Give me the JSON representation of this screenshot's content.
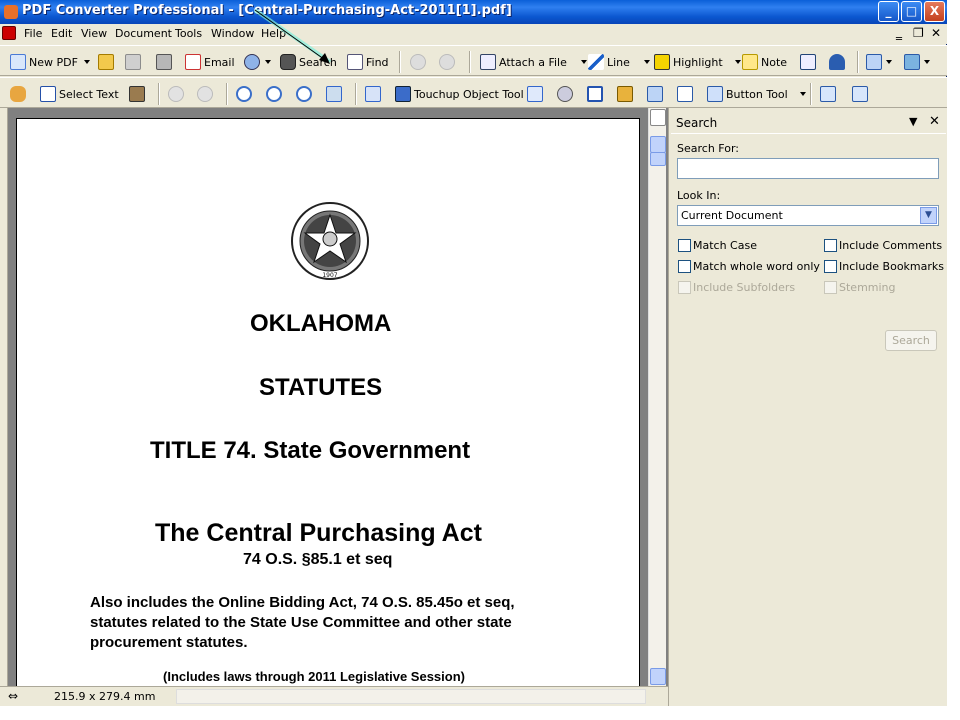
{
  "window": {
    "title": "PDF Converter Professional - [Central-Purchasing-Act-2011[1].pdf]",
    "controls": [
      "_",
      "□",
      "X"
    ]
  },
  "menubar": {
    "items": [
      "File",
      "Edit",
      "View",
      "Document",
      "Tools",
      "Window",
      "Help"
    ]
  },
  "toolbar1": {
    "new_pdf": "New PDF",
    "email": "Email",
    "search": "Search",
    "find": "Find",
    "attach": "Attach a File",
    "line": "Line",
    "highlight": "Highlight",
    "note": "Note"
  },
  "toolbar2": {
    "select_text": "Select Text",
    "touchup": "Touchup Object Tool",
    "button_tool": "Button Tool"
  },
  "document": {
    "line1": "OKLAHOMA",
    "line2": "STATUTES",
    "line3": "TITLE 74.  State Government",
    "line4": "The Central Purchasing Act",
    "line5": "74 O.S. §85.1 et seq",
    "para1": "Also includes the Online Bidding Act, 74 O.S. 85.45o et seq,",
    "para2": "statutes related to the State Use Committee and other state",
    "para3": "procurement statutes.",
    "includes": "(Includes laws through 2011 Legislative Session)",
    "seal_year": "1907"
  },
  "statusbar": {
    "page_size": "215.9 x 279.4 mm"
  },
  "search_panel": {
    "title": "Search",
    "search_for_label": "Search For:",
    "search_for_value": "",
    "look_in_label": "Look In:",
    "look_in_value": "Current Document",
    "match_case": "Match Case",
    "include_comments": "Include Comments",
    "match_whole": "Match whole word only",
    "include_bookmarks": "Include Bookmarks",
    "include_subfolders": "Include Subfolders",
    "stemming": "Stemming",
    "search_button": "Search"
  },
  "colors": {
    "titlebar": "#0b57d0",
    "chrome": "#ece9d8",
    "doc_background": "#808080"
  }
}
